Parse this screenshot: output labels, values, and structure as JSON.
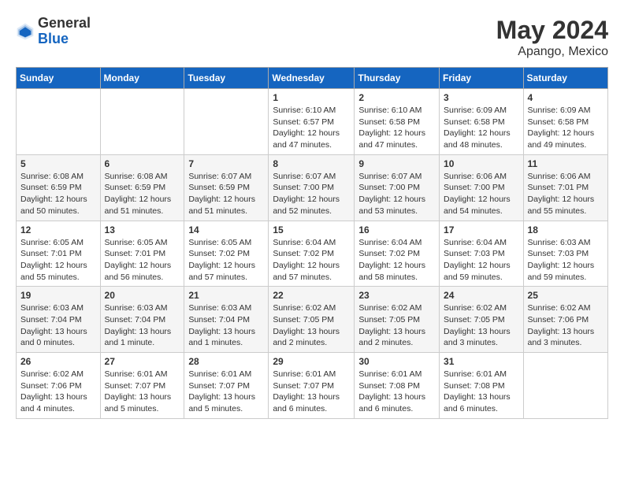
{
  "header": {
    "logo_general": "General",
    "logo_blue": "Blue",
    "month": "May 2024",
    "location": "Apango, Mexico"
  },
  "weekdays": [
    "Sunday",
    "Monday",
    "Tuesday",
    "Wednesday",
    "Thursday",
    "Friday",
    "Saturday"
  ],
  "weeks": [
    [
      {
        "day": "",
        "info": ""
      },
      {
        "day": "",
        "info": ""
      },
      {
        "day": "",
        "info": ""
      },
      {
        "day": "1",
        "info": "Sunrise: 6:10 AM\nSunset: 6:57 PM\nDaylight: 12 hours and 47 minutes."
      },
      {
        "day": "2",
        "info": "Sunrise: 6:10 AM\nSunset: 6:58 PM\nDaylight: 12 hours and 47 minutes."
      },
      {
        "day": "3",
        "info": "Sunrise: 6:09 AM\nSunset: 6:58 PM\nDaylight: 12 hours and 48 minutes."
      },
      {
        "day": "4",
        "info": "Sunrise: 6:09 AM\nSunset: 6:58 PM\nDaylight: 12 hours and 49 minutes."
      }
    ],
    [
      {
        "day": "5",
        "info": "Sunrise: 6:08 AM\nSunset: 6:59 PM\nDaylight: 12 hours and 50 minutes."
      },
      {
        "day": "6",
        "info": "Sunrise: 6:08 AM\nSunset: 6:59 PM\nDaylight: 12 hours and 51 minutes."
      },
      {
        "day": "7",
        "info": "Sunrise: 6:07 AM\nSunset: 6:59 PM\nDaylight: 12 hours and 51 minutes."
      },
      {
        "day": "8",
        "info": "Sunrise: 6:07 AM\nSunset: 7:00 PM\nDaylight: 12 hours and 52 minutes."
      },
      {
        "day": "9",
        "info": "Sunrise: 6:07 AM\nSunset: 7:00 PM\nDaylight: 12 hours and 53 minutes."
      },
      {
        "day": "10",
        "info": "Sunrise: 6:06 AM\nSunset: 7:00 PM\nDaylight: 12 hours and 54 minutes."
      },
      {
        "day": "11",
        "info": "Sunrise: 6:06 AM\nSunset: 7:01 PM\nDaylight: 12 hours and 55 minutes."
      }
    ],
    [
      {
        "day": "12",
        "info": "Sunrise: 6:05 AM\nSunset: 7:01 PM\nDaylight: 12 hours and 55 minutes."
      },
      {
        "day": "13",
        "info": "Sunrise: 6:05 AM\nSunset: 7:01 PM\nDaylight: 12 hours and 56 minutes."
      },
      {
        "day": "14",
        "info": "Sunrise: 6:05 AM\nSunset: 7:02 PM\nDaylight: 12 hours and 57 minutes."
      },
      {
        "day": "15",
        "info": "Sunrise: 6:04 AM\nSunset: 7:02 PM\nDaylight: 12 hours and 57 minutes."
      },
      {
        "day": "16",
        "info": "Sunrise: 6:04 AM\nSunset: 7:02 PM\nDaylight: 12 hours and 58 minutes."
      },
      {
        "day": "17",
        "info": "Sunrise: 6:04 AM\nSunset: 7:03 PM\nDaylight: 12 hours and 59 minutes."
      },
      {
        "day": "18",
        "info": "Sunrise: 6:03 AM\nSunset: 7:03 PM\nDaylight: 12 hours and 59 minutes."
      }
    ],
    [
      {
        "day": "19",
        "info": "Sunrise: 6:03 AM\nSunset: 7:04 PM\nDaylight: 13 hours and 0 minutes."
      },
      {
        "day": "20",
        "info": "Sunrise: 6:03 AM\nSunset: 7:04 PM\nDaylight: 13 hours and 1 minute."
      },
      {
        "day": "21",
        "info": "Sunrise: 6:03 AM\nSunset: 7:04 PM\nDaylight: 13 hours and 1 minutes."
      },
      {
        "day": "22",
        "info": "Sunrise: 6:02 AM\nSunset: 7:05 PM\nDaylight: 13 hours and 2 minutes."
      },
      {
        "day": "23",
        "info": "Sunrise: 6:02 AM\nSunset: 7:05 PM\nDaylight: 13 hours and 2 minutes."
      },
      {
        "day": "24",
        "info": "Sunrise: 6:02 AM\nSunset: 7:05 PM\nDaylight: 13 hours and 3 minutes."
      },
      {
        "day": "25",
        "info": "Sunrise: 6:02 AM\nSunset: 7:06 PM\nDaylight: 13 hours and 3 minutes."
      }
    ],
    [
      {
        "day": "26",
        "info": "Sunrise: 6:02 AM\nSunset: 7:06 PM\nDaylight: 13 hours and 4 minutes."
      },
      {
        "day": "27",
        "info": "Sunrise: 6:01 AM\nSunset: 7:07 PM\nDaylight: 13 hours and 5 minutes."
      },
      {
        "day": "28",
        "info": "Sunrise: 6:01 AM\nSunset: 7:07 PM\nDaylight: 13 hours and 5 minutes."
      },
      {
        "day": "29",
        "info": "Sunrise: 6:01 AM\nSunset: 7:07 PM\nDaylight: 13 hours and 6 minutes."
      },
      {
        "day": "30",
        "info": "Sunrise: 6:01 AM\nSunset: 7:08 PM\nDaylight: 13 hours and 6 minutes."
      },
      {
        "day": "31",
        "info": "Sunrise: 6:01 AM\nSunset: 7:08 PM\nDaylight: 13 hours and 6 minutes."
      },
      {
        "day": "",
        "info": ""
      }
    ]
  ]
}
